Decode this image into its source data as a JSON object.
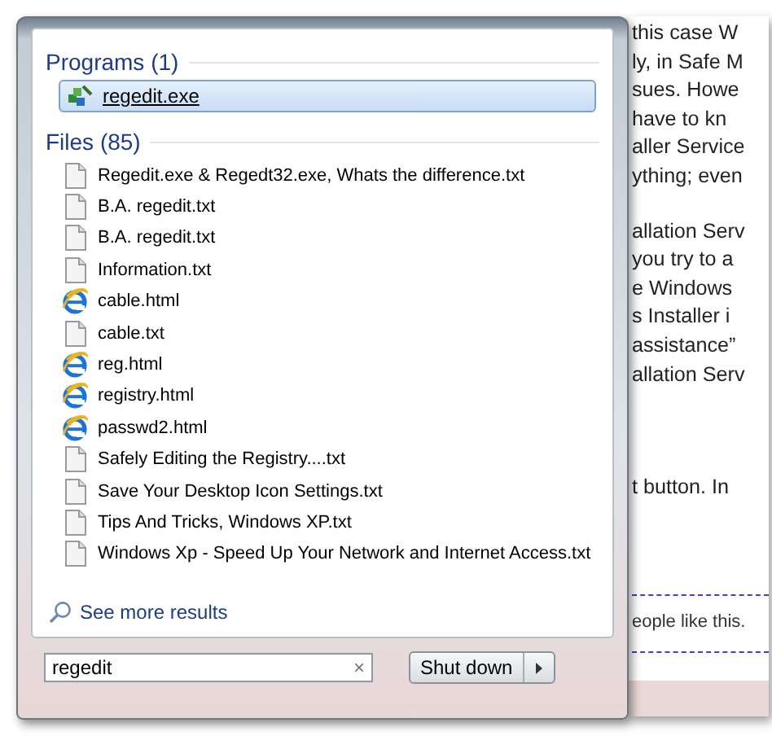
{
  "programs": {
    "heading": "Programs (1)",
    "items": [
      {
        "name": "regedit.exe",
        "selected": true
      }
    ]
  },
  "files": {
    "heading": "Files (85)",
    "items": [
      {
        "name": "Regedit.exe & Regedt32.exe, Whats the difference.txt",
        "kind": "text"
      },
      {
        "name": "B.A. regedit.txt",
        "kind": "text"
      },
      {
        "name": "B.A. regedit.txt",
        "kind": "text"
      },
      {
        "name": "Information.txt",
        "kind": "text"
      },
      {
        "name": "cable.html",
        "kind": "web"
      },
      {
        "name": "cable.txt",
        "kind": "text"
      },
      {
        "name": "reg.html",
        "kind": "web"
      },
      {
        "name": "registry.html",
        "kind": "web"
      },
      {
        "name": "passwd2.html",
        "kind": "web"
      },
      {
        "name": "Safely Editing the Registry....txt",
        "kind": "text"
      },
      {
        "name": "Save Your Desktop Icon Settings.txt",
        "kind": "text"
      },
      {
        "name": "Tips And Tricks, Windows XP.txt",
        "kind": "text"
      },
      {
        "name": "Windows Xp - Speed Up Your Network and Internet Access.txt",
        "kind": "text"
      }
    ]
  },
  "see_more": "See more results",
  "search": {
    "value": "regedit",
    "clear": "×"
  },
  "shutdown": {
    "label": "Shut down"
  },
  "background_document": {
    "paragraphs": [
      [
        "this case W",
        "ly, in Safe M",
        "sues. Howe",
        "have to kn",
        "aller Service",
        "ything; even"
      ],
      [
        "allation Serv",
        "you try to a",
        "e Windows",
        "s Installer i",
        "assistance”",
        "allation Serv"
      ],
      [
        "t button. In"
      ]
    ],
    "comment": "eople like this."
  }
}
